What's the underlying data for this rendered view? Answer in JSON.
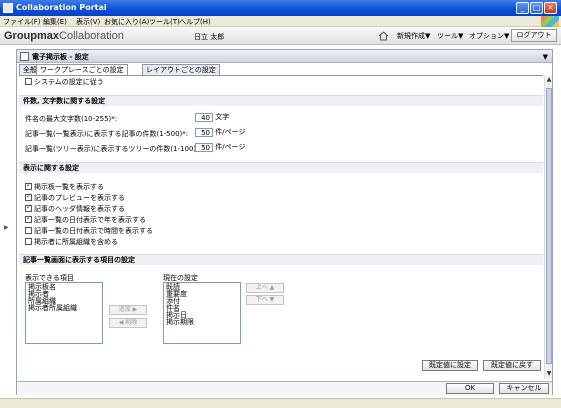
{
  "window": {
    "title": "Collaboration Portal"
  },
  "menu": [
    "ファイル(F)",
    "編集(E)",
    "表示(V)",
    "お気に入り(A)",
    "ツール(T)",
    "ヘルプ(H)"
  ],
  "header": {
    "logo_bold": "Groupmax",
    "logo_light": "Collaboration",
    "user": "日立 太郎",
    "new_menu": "新規作成▼",
    "tool_menu": "ツール▼",
    "option_menu": "オプション▼",
    "logout": "ログアウト"
  },
  "portlet": {
    "title": "電子掲示板 - 設定",
    "tabs": [
      "全般",
      "ワークプレースごとの設定",
      "レイアウトごとの設定"
    ]
  },
  "settings": {
    "use_system": {
      "label": "システムの設定に従う",
      "checked": false
    },
    "count_section": "件数, 文字数に関する設定",
    "fields": [
      {
        "label": "件名の最大文字数(10-255)*:",
        "value": "40",
        "unit": "文字"
      },
      {
        "label": "記事一覧(一覧表示)に表示する記事の件数(1-500)*:",
        "value": "50",
        "unit": "件/ページ"
      },
      {
        "label": "記事一覧(ツリー表示)に表示するツリーの件数(1-100)*:",
        "value": "50",
        "unit": "件/ページ"
      }
    ],
    "display_section": "表示に関する設定",
    "display_options": [
      {
        "label": "掲示板一覧を表示する",
        "checked": true
      },
      {
        "label": "記事のプレビューを表示する",
        "checked": true
      },
      {
        "label": "記事のヘッダ情報を表示する",
        "checked": true
      },
      {
        "label": "記事一覧の日付表示で年を表示する",
        "checked": true
      },
      {
        "label": "記事一覧の日付表示で時間を表示する",
        "checked": false
      },
      {
        "label": "掲示者に所属組織を含める",
        "checked": false
      }
    ],
    "list_section": "記事一覧画面に表示する項目の設定",
    "available_label": "表示できる項目",
    "current_label": "現在の設定",
    "available_items": [
      "掲示板名",
      "掲示者",
      "所属組織",
      "掲示者所属組織"
    ],
    "current_items": [
      "既読",
      "重要度",
      "添付",
      "件名",
      "掲示日",
      "掲示期限"
    ],
    "add_button": "追加 ▶",
    "remove_button": "◀ 削除",
    "up_button": "上へ ▲",
    "down_button": "下へ ▼",
    "set_default": "既定値に設定",
    "restore_default": "既定値に戻す"
  },
  "footer": {
    "ok": "OK",
    "cancel": "キャンセル"
  }
}
